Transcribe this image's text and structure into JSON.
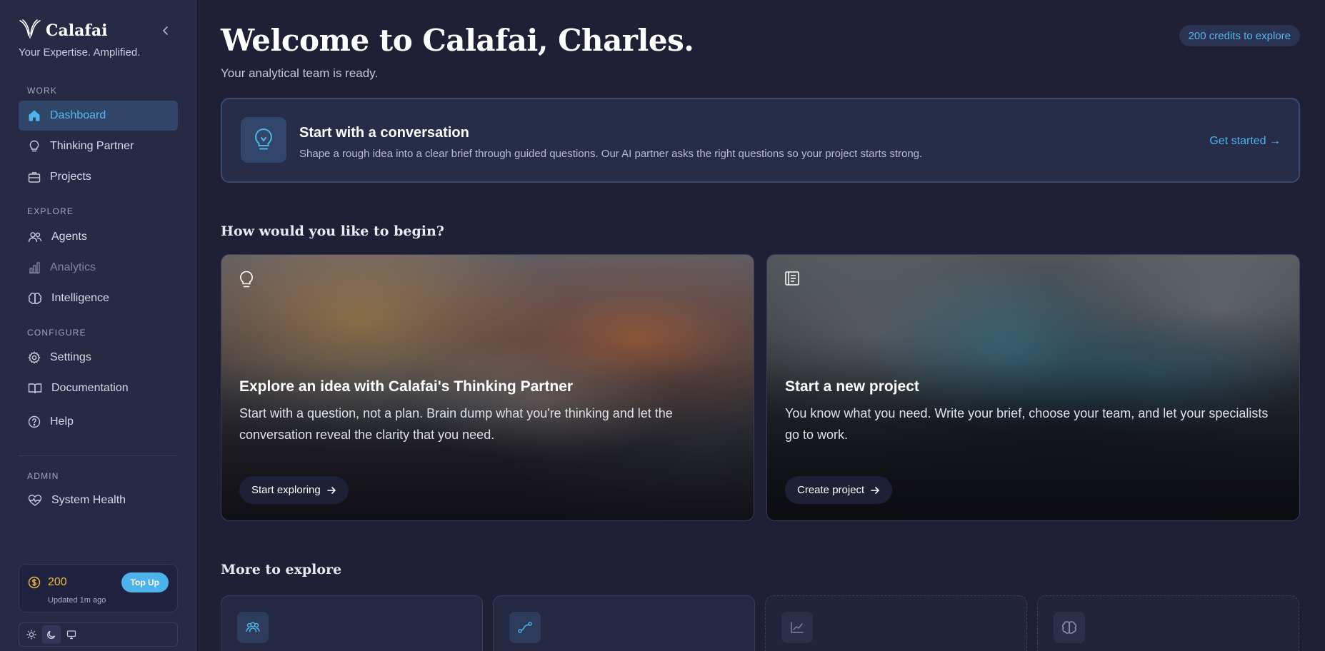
{
  "sidebar": {
    "brand": "Calafai",
    "tagline": "Your Expertise. Amplified.",
    "sections": {
      "work": "WORK",
      "explore": "EXPLORE",
      "configure": "CONFIGURE",
      "admin": "ADMIN"
    },
    "items": {
      "dashboard": "Dashboard",
      "thinking_partner": "Thinking Partner",
      "projects": "Projects",
      "agents": "Agents",
      "analytics": "Analytics",
      "intelligence": "Intelligence",
      "settings": "Settings",
      "documentation": "Documentation",
      "help": "Help",
      "system_health": "System Health"
    },
    "credits": {
      "amount": "200",
      "topup_label": "Top Up",
      "updated": "Updated 1m ago"
    }
  },
  "header": {
    "title": "Welcome to Calafai, Charles.",
    "subtitle": "Your analytical team is ready.",
    "credits_pill": "200 credits to explore"
  },
  "conversation_card": {
    "title": "Start with a conversation",
    "description": "Shape a rough idea into a clear brief through guided questions. Our AI partner asks the right questions so your project starts strong.",
    "link": "Get started →"
  },
  "begin": {
    "heading": "How would you like to begin?",
    "cards": [
      {
        "title": "Explore an idea with Calafai's Thinking Partner",
        "description": "Start with a question, not a plan. Brain dump what you're thinking and let the conversation reveal the clarity that you need.",
        "button": "Start exploring"
      },
      {
        "title": "Start a new project",
        "description": "You know what you need. Write your brief, choose your team, and let your specialists go to work.",
        "button": "Create project"
      }
    ]
  },
  "more": {
    "heading": "More to explore"
  },
  "colors": {
    "accent": "#4cb4ea",
    "background": "#1f2036",
    "sidebar": "#272a44",
    "credit_gold": "#f3b93b"
  }
}
